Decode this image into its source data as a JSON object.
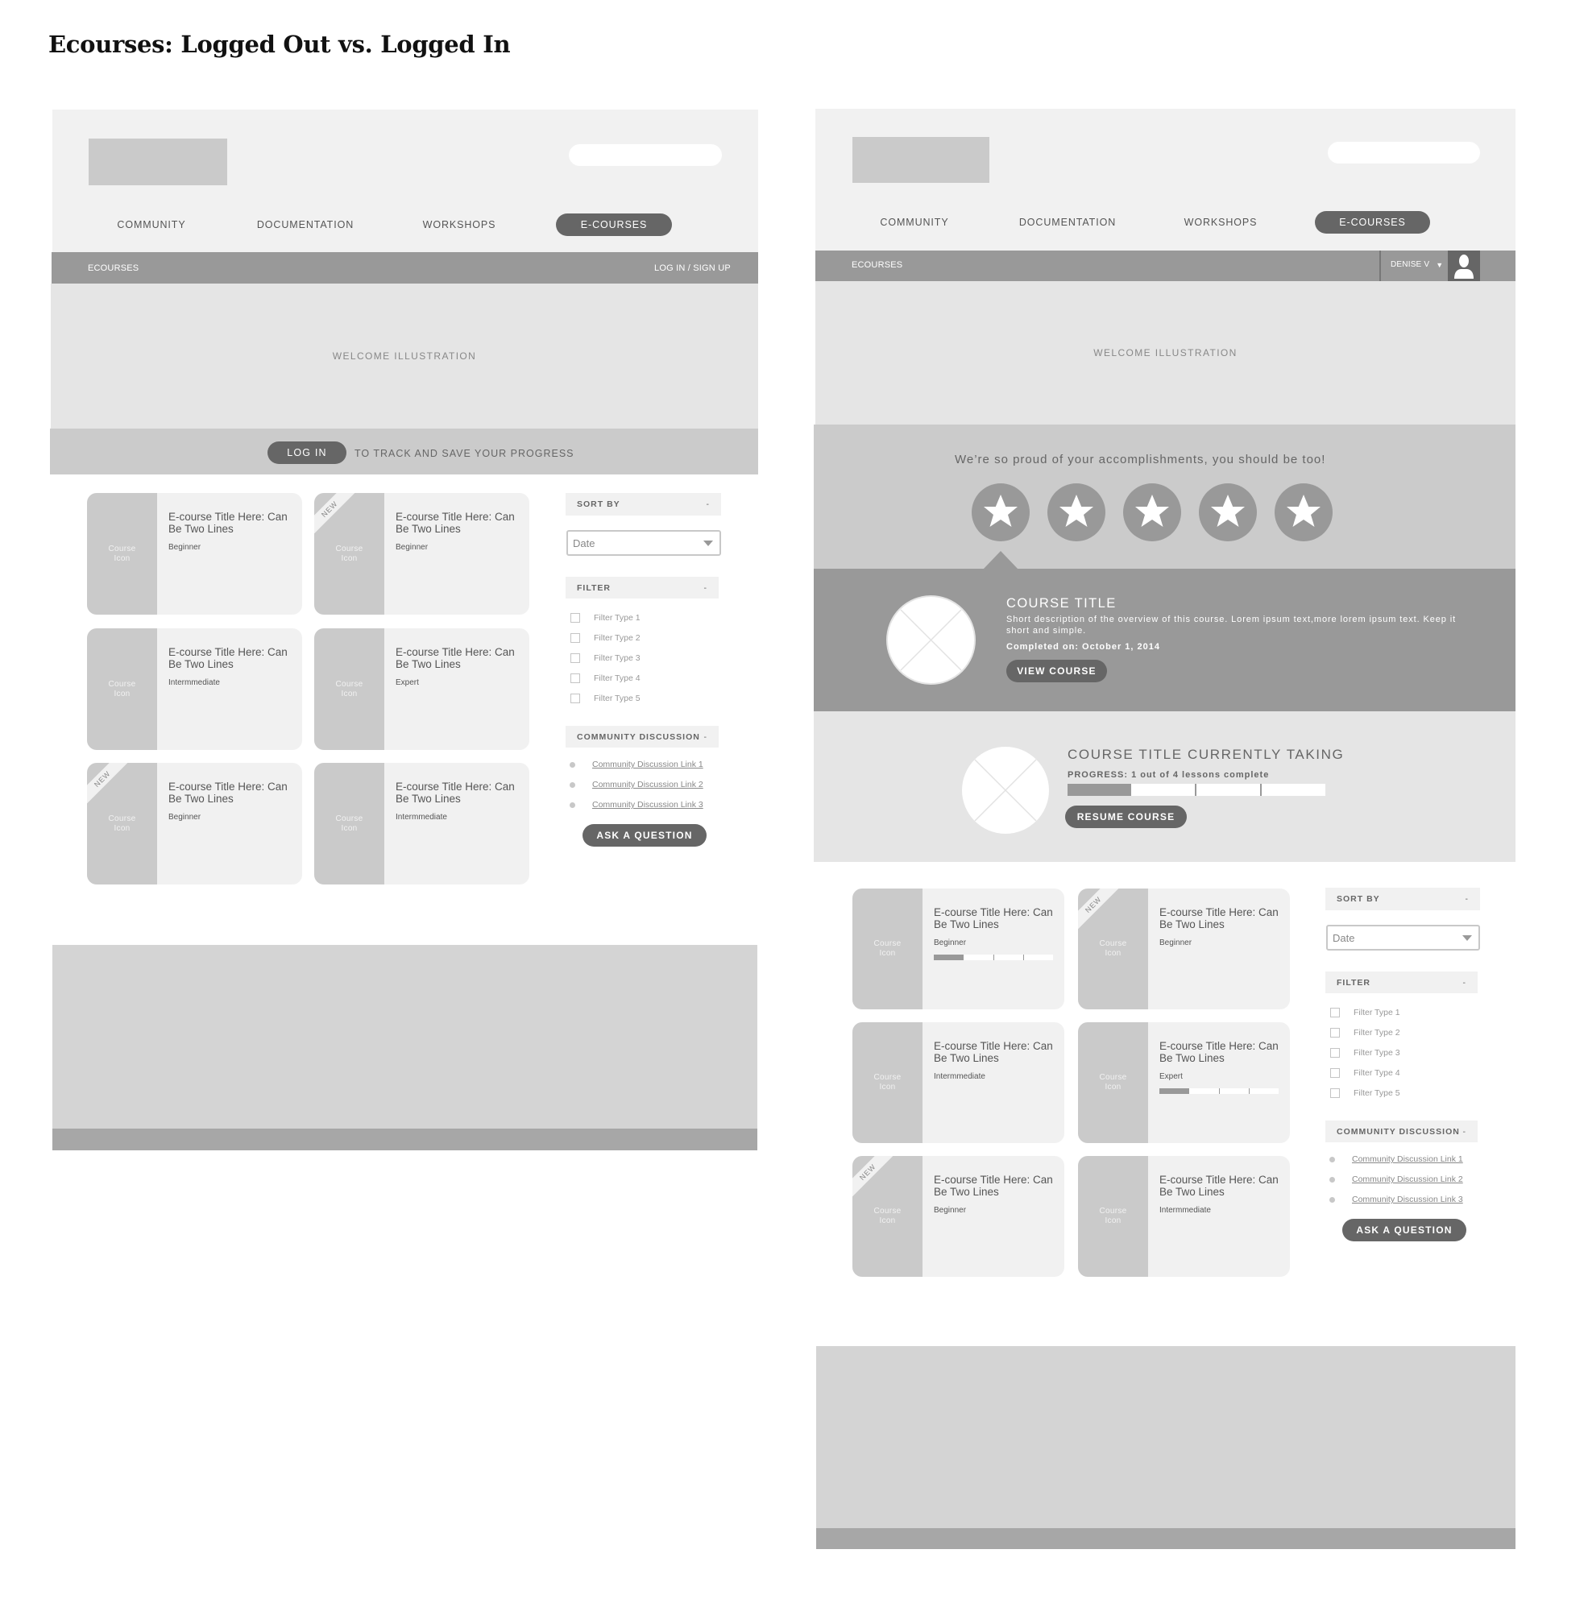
{
  "page_title": "Ecourses: Logged Out vs. Logged In",
  "colors": {
    "header_bg": "#f1f1f1",
    "accent_dark": "#666666",
    "bar_gray": "#999999",
    "hero_bg": "#e5e5e5",
    "placeholder": "#cacaca"
  },
  "nav": {
    "items": [
      "COMMUNITY",
      "DOCUMENTATION",
      "WORKSHOPS",
      "E-COURSES"
    ],
    "active": "E-COURSES"
  },
  "logged_out": {
    "breadcrumb": "ECOURSES",
    "login_link": "LOG IN / SIGN UP",
    "hero_label": "WELCOME ILLUSTRATION",
    "login_button": "LOG IN",
    "login_message": "TO TRACK AND SAVE YOUR PROGRESS",
    "cards": [
      {
        "icon_label": "Course Icon",
        "title": "E-course Title Here: Can Be Two Lines",
        "level": "Beginner",
        "new": false
      },
      {
        "icon_label": "Course Icon",
        "title": "E-course Title Here: Can Be Two Lines",
        "level": "Beginner",
        "new": true
      },
      {
        "icon_label": "Course Icon",
        "title": "E-course Title Here: Can Be Two Lines",
        "level": "Intermmediate",
        "new": false
      },
      {
        "icon_label": "Course Icon",
        "title": "E-course Title Here: Can Be Two Lines",
        "level": "Expert",
        "new": false
      },
      {
        "icon_label": "Course Icon",
        "title": "E-course Title Here: Can Be Two Lines",
        "level": "Beginner",
        "new": true
      },
      {
        "icon_label": "Course Icon",
        "title": "E-course Title Here: Can Be Two Lines",
        "level": "Intermmediate",
        "new": false
      }
    ]
  },
  "logged_in": {
    "breadcrumb": "ECOURSES",
    "user_name": "DENISE V",
    "user_caret": "▼",
    "hero_label": "WELCOME ILLUSTRATION",
    "proud_message": "We’re so proud of your accomplishments, you should be too!",
    "badges_earned": 5,
    "badges": [
      "star",
      "star",
      "star",
      "star",
      "star"
    ],
    "completed_course": {
      "title": "COURSE TITLE",
      "description": "Short description of the overview of this course. Lorem ipsum text,more lorem ipsum text. Keep it short and simple.",
      "completed_on": "Completed on: October 1, 2014",
      "button": "VIEW COURSE"
    },
    "current_course": {
      "title": "COURSE TITLE CURRENTLY TAKING",
      "progress_label": "PROGRESS: 1 out of 4 lessons complete",
      "lessons_complete": 1,
      "lessons_total": 4,
      "button": "RESUME COURSE"
    },
    "cards": [
      {
        "icon_label": "Course Icon",
        "title": "E-course Title Here: Can Be Two Lines",
        "level": "Beginner",
        "new": false,
        "progress": {
          "done": 1,
          "total": 4
        }
      },
      {
        "icon_label": "Course Icon",
        "title": "E-course Title Here: Can Be Two Lines",
        "level": "Beginner",
        "new": true,
        "progress": null
      },
      {
        "icon_label": "Course Icon",
        "title": "E-course Title Here: Can Be Two Lines",
        "level": "Intermmediate",
        "new": false,
        "progress": null
      },
      {
        "icon_label": "Course Icon",
        "title": "E-course Title Here: Can Be Two Lines",
        "level": "Expert",
        "new": false,
        "progress": {
          "done": 1,
          "total": 4
        }
      },
      {
        "icon_label": "Course Icon",
        "title": "E-course Title Here: Can Be Two Lines",
        "level": "Beginner",
        "new": true,
        "progress": null
      },
      {
        "icon_label": "Course Icon",
        "title": "E-course Title Here: Can Be Two Lines",
        "level": "Intermmediate",
        "new": false,
        "progress": null
      }
    ]
  },
  "sidebar": {
    "sort_by_label": "SORT BY",
    "collapse_symbol": "-",
    "sort_value": "Date",
    "filter_label": "FILTER",
    "filters": [
      "Filter Type 1",
      "Filter Type 2",
      "Filter Type 3",
      "Filter Type 4",
      "Filter Type 5"
    ],
    "community_label": "COMMUNITY DISCUSSION",
    "links": [
      "Community Discussion Link 1",
      "Community Discussion Link 2",
      "Community Discussion Link 3"
    ],
    "ask_button": "ASK A QUESTION"
  },
  "new_badge": "NEW"
}
